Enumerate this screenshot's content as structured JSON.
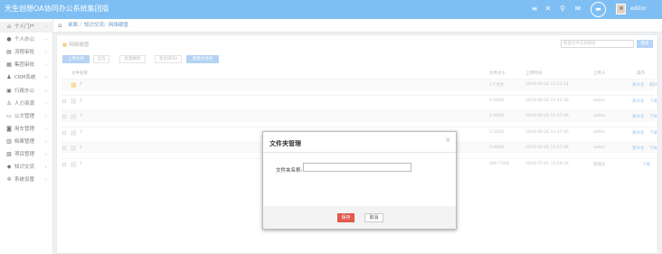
{
  "header": {
    "brand": "天生创想OA协同办公系统集团版",
    "user_name": "editor",
    "icons": [
      "menu-icon",
      "expand-icon",
      "bell-icon",
      "message-icon",
      "chat-icon"
    ]
  },
  "sidebar": {
    "items": [
      {
        "label": "个人门户",
        "icon": "home-icon",
        "glyph": "⌂",
        "active": true
      },
      {
        "label": "个人办公",
        "icon": "user-icon",
        "glyph": "●"
      },
      {
        "label": "流程审批",
        "icon": "workflow-icon",
        "glyph": "▤"
      },
      {
        "label": "集团审批",
        "icon": "group-icon",
        "glyph": "▦"
      },
      {
        "label": "CRM系统",
        "icon": "crm-icon",
        "glyph": "♟"
      },
      {
        "label": "行政办公",
        "icon": "briefcase-icon",
        "glyph": "▣"
      },
      {
        "label": "人力资源",
        "icon": "people-icon",
        "glyph": "♙"
      },
      {
        "label": "公文管理",
        "icon": "folder-icon",
        "glyph": "▭"
      },
      {
        "label": "用车管理",
        "icon": "car-icon",
        "glyph": "◙"
      },
      {
        "label": "档案管理",
        "icon": "archive-icon",
        "glyph": "▥"
      },
      {
        "label": "项目管理",
        "icon": "project-icon",
        "glyph": "▧"
      },
      {
        "label": "知识交流",
        "icon": "knowledge-icon",
        "glyph": "◆"
      },
      {
        "label": "系统设置",
        "icon": "settings-icon",
        "glyph": "✲"
      }
    ]
  },
  "breadcrumb": [
    "桌面",
    "知识交流",
    "网络硬盘"
  ],
  "panel": {
    "title": "网络硬盘",
    "search_placeholder": "根据文件名称搜索",
    "search_button": "搜索",
    "toolbar": [
      "上传文件",
      "全选",
      "批量删除",
      "更多操作▾",
      "新建文件夹"
    ],
    "columns": [
      "文件名称",
      "文件大小",
      "上传时间",
      "上传人",
      "操作"
    ],
    "rows": [
      {
        "name": "4",
        "size": "1个文件",
        "time": "2019-08-26 12:21:14",
        "uploader": "",
        "actions": [
          "重命名",
          "删除"
        ],
        "type": "folder"
      },
      {
        "name": "4",
        "size": "0.01KB",
        "time": "2019-08-26 11:45:16",
        "uploader": "editor",
        "actions": [
          "重命名",
          "下载"
        ],
        "type": "doc"
      },
      {
        "name": "3",
        "size": "0.00KB",
        "time": "2019-08-26 11:47:49",
        "uploader": "editor",
        "actions": [
          "重命名",
          "下载"
        ],
        "type": "doc"
      },
      {
        "name": "3",
        "size": "0.32KB",
        "time": "2019-08-26 11:47:46",
        "uploader": "editor",
        "actions": [
          "重命名",
          "下载"
        ],
        "type": "doc"
      },
      {
        "name": "2",
        "size": "0.46KB",
        "time": "2019-08-26 11:47:46",
        "uploader": "editor",
        "actions": [
          "重命名",
          "下载"
        ],
        "type": "doc"
      },
      {
        "name": "1",
        "size": "280.73KB",
        "time": "2019-07-01 10:24:19",
        "uploader": "管理员",
        "actions": [
          "下载"
        ],
        "type": "doc"
      }
    ]
  },
  "modal": {
    "title": "文件夹管理",
    "close_glyph": "×",
    "field_label": "文件夹名称:",
    "field_value": "",
    "save": "保存",
    "cancel": "取消"
  }
}
